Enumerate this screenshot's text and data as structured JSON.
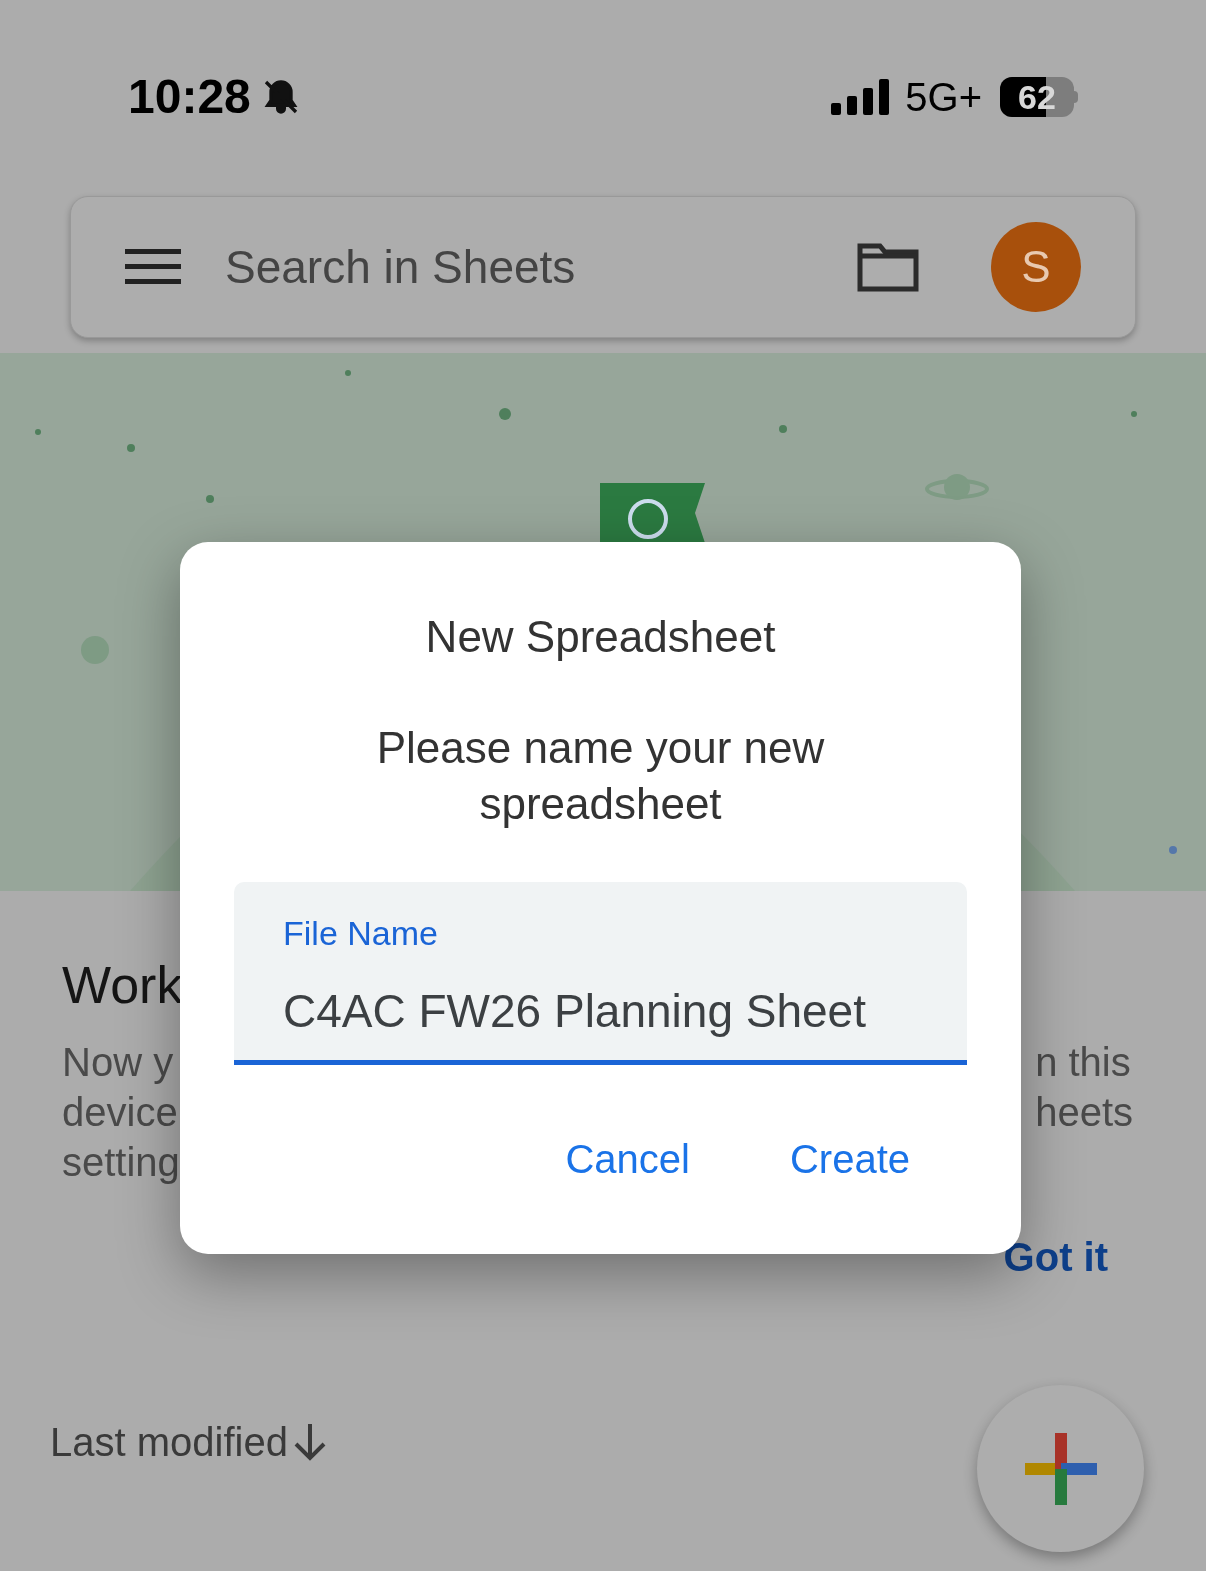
{
  "status_bar": {
    "time": "10:28",
    "network": "5G+",
    "battery": "62"
  },
  "search_bar": {
    "placeholder": "Search in Sheets",
    "avatar": "S"
  },
  "promo": {
    "title": "Work",
    "left_lines": [
      "Now y",
      "device",
      "setting"
    ],
    "right_lines": [
      "n this",
      "heets"
    ],
    "action": "Got it"
  },
  "sort": {
    "label": "Last modified"
  },
  "dialog": {
    "title": "New Spreadsheet",
    "message": "Please name your new spreadsheet",
    "field": {
      "label": "File Name",
      "value": "C4AC FW26 Planning Sheet"
    },
    "buttons": [
      {
        "label": "Cancel"
      },
      {
        "label": "Create"
      }
    ]
  }
}
